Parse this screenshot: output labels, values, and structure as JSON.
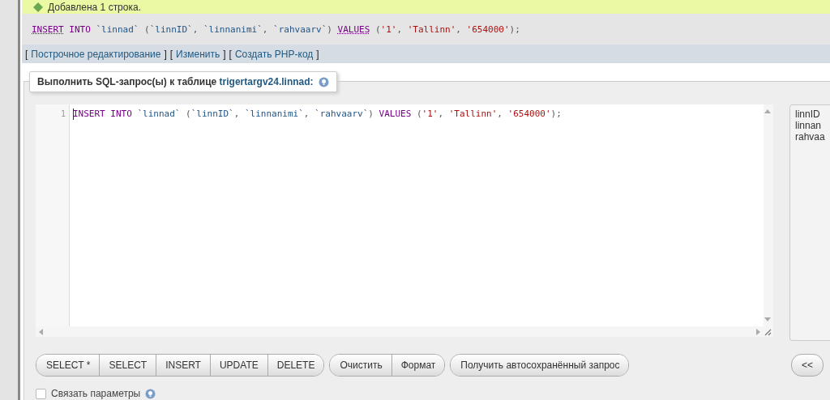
{
  "success_message": "Добавлена 1 строка.",
  "executed_query": [
    {
      "text": "INSERT",
      "kind": "keyword"
    },
    {
      "text": " INTO ",
      "kind": "keyword2"
    },
    {
      "text": "`linnad`",
      "kind": "identifier"
    },
    {
      "text": " (",
      "kind": "punct"
    },
    {
      "text": "`linnID`",
      "kind": "identifier"
    },
    {
      "text": ", ",
      "kind": "punct"
    },
    {
      "text": "`linnanimi`",
      "kind": "identifier"
    },
    {
      "text": ", ",
      "kind": "punct"
    },
    {
      "text": "`rahvaarv`",
      "kind": "identifier"
    },
    {
      "text": ") ",
      "kind": "punct"
    },
    {
      "text": "VALUES",
      "kind": "keyword"
    },
    {
      "text": " (",
      "kind": "punct"
    },
    {
      "text": "'1'",
      "kind": "string"
    },
    {
      "text": ", ",
      "kind": "punct"
    },
    {
      "text": "'Tallinn'",
      "kind": "string"
    },
    {
      "text": ", ",
      "kind": "punct"
    },
    {
      "text": "'654000'",
      "kind": "string"
    },
    {
      "text": ");",
      "kind": "punct"
    }
  ],
  "action_links": [
    {
      "open": "[",
      "label": "Построчное редактирование",
      "close": "]"
    },
    {
      "open": "[",
      "label": "Изменить",
      "close": "]"
    },
    {
      "open": "[",
      "label": "Создать PHP-код",
      "close": "]"
    }
  ],
  "query_box": {
    "legend_text": "Выполнить SQL-запрос(ы) к таблице ",
    "legend_table": "trigertargv24.linnad:",
    "editor": {
      "line_number": "1",
      "tokens": [
        {
          "text": "INSERT INTO ",
          "kind": "keyword2"
        },
        {
          "text": "`linnad`",
          "kind": "identifier"
        },
        {
          "text": " (",
          "kind": "punct"
        },
        {
          "text": "`linnID`",
          "kind": "identifier"
        },
        {
          "text": ", ",
          "kind": "punct"
        },
        {
          "text": "`linnanimi`",
          "kind": "identifier"
        },
        {
          "text": ", ",
          "kind": "punct"
        },
        {
          "text": "`rahvaarv`",
          "kind": "identifier"
        },
        {
          "text": ") ",
          "kind": "punct"
        },
        {
          "text": "VALUES",
          "kind": "keyword2"
        },
        {
          "text": " (",
          "kind": "punct"
        },
        {
          "text": "'1'",
          "kind": "string"
        },
        {
          "text": ", ",
          "kind": "punct"
        },
        {
          "text": "'Tallinn'",
          "kind": "string"
        },
        {
          "text": ", ",
          "kind": "punct"
        },
        {
          "text": "'654000'",
          "kind": "string"
        },
        {
          "text": ");",
          "kind": "punct"
        }
      ]
    },
    "columns": [
      "linnID",
      "linnan",
      "rahvaa"
    ],
    "button_groups": [
      [
        "SELECT *",
        "SELECT",
        "INSERT",
        "UPDATE",
        "DELETE"
      ],
      [
        "Очистить",
        "Формат"
      ],
      [
        "Получить автосохранённый запрос"
      ]
    ],
    "insert_columns_button": "<<",
    "bind_parameters": {
      "label": "Связать параметры",
      "checked": false
    }
  }
}
